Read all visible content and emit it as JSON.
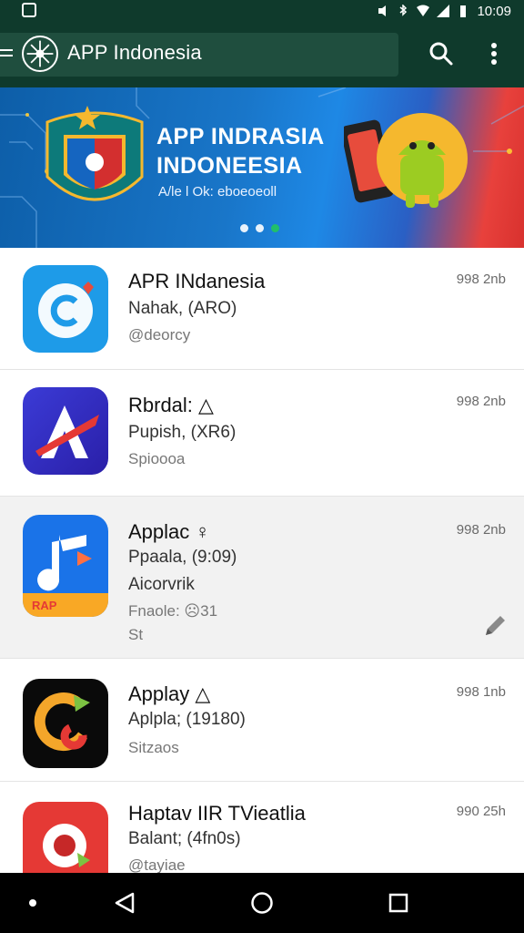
{
  "status_bar": {
    "time": "10:09"
  },
  "app_bar": {
    "title": "APP Indonesia",
    "menu_icon": "menu-icon",
    "logo_icon": "compass-logo-icon",
    "search_icon": "search-icon",
    "more_icon": "more-vert-icon"
  },
  "banner": {
    "title_line1": "APP INDRASIA",
    "title_line2": "INDONEESIA",
    "subtitle": "A/le l Ok: eboeoeoll",
    "page_dots": 3,
    "active_dot": 3
  },
  "apps": [
    {
      "name": "APR INdanesia",
      "line2": "Nahak, (ARO)",
      "line3": "@deorcy",
      "line4": "",
      "size": "998 2nb",
      "icon": "chat-app-icon",
      "highlight": false
    },
    {
      "name": "Rbrdal: △",
      "line2": "Pupish, (XR6)",
      "line3": "Spioooa",
      "line4": "",
      "size": "998 2nb",
      "icon": "arrow-a-app-icon",
      "highlight": false
    },
    {
      "name": "Applac ♀",
      "line2": "Ppaala, (9:09)",
      "line3": "Aicorvrik",
      "line4": "Fnaole: ☹31",
      "line5": "St",
      "size": "998 2nb",
      "icon": "music-app-icon",
      "highlight": true,
      "action_icon": "edit-pencil-icon"
    },
    {
      "name": "Applay △",
      "line2": "Aplpla; (19180)",
      "line3": "Sitzaos",
      "line4": "",
      "size": "998 1nb",
      "icon": "swirl-app-icon",
      "highlight": false
    },
    {
      "name": "Haptav IIR TVieatlia",
      "line2": "Balant; (4fn0s)",
      "line3": "@tayiae",
      "line4": "",
      "size": "990 25h",
      "icon": "record-app-icon",
      "highlight": false
    }
  ],
  "colors": {
    "app_bar": "#0f3a2c",
    "accent_green": "#22c55e",
    "banner_blue": "#1976c9",
    "banner_red": "#d8312e"
  },
  "nav_bar": {
    "back_icon": "back-triangle-icon",
    "home_icon": "home-circle-icon",
    "recent_icon": "recent-square-icon"
  }
}
